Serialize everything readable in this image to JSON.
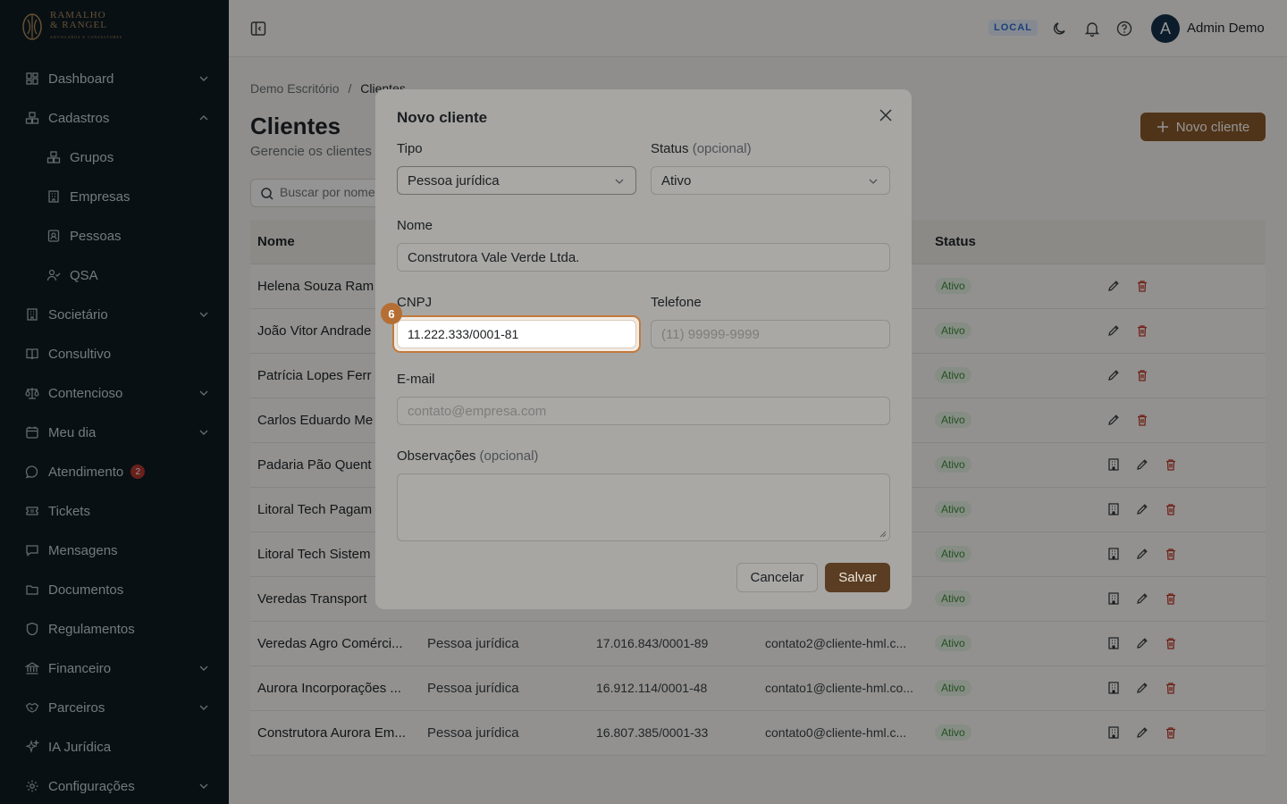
{
  "brand": {
    "name_line1": "RAMALHO",
    "name_line2": "& RANGEL",
    "tagline": "ADVOGADOS E CONSULTORES"
  },
  "sidebar": {
    "items": [
      {
        "label": "Dashboard",
        "icon": "dashboard-icon",
        "chevron": "down"
      },
      {
        "label": "Cadastros",
        "icon": "boxes-icon",
        "chevron": "up"
      },
      {
        "label": "Grupos",
        "icon": "boxes-icon",
        "sub": true
      },
      {
        "label": "Empresas",
        "icon": "building-icon",
        "sub": true
      },
      {
        "label": "Pessoas",
        "icon": "contact-icon",
        "sub": true
      },
      {
        "label": "QSA",
        "icon": "user-check-icon",
        "sub": true
      },
      {
        "label": "Societário",
        "icon": "building-icon",
        "chevron": "down"
      },
      {
        "label": "Consultivo",
        "icon": "book-icon"
      },
      {
        "label": "Contencioso",
        "icon": "scale-icon",
        "chevron": "down"
      },
      {
        "label": "Meu dia",
        "icon": "calendar-icon",
        "chevron": "down"
      },
      {
        "label": "Atendimento",
        "icon": "chat-icon",
        "badge": "2"
      },
      {
        "label": "Tickets",
        "icon": "ticket-icon"
      },
      {
        "label": "Mensagens",
        "icon": "message-icon"
      },
      {
        "label": "Documentos",
        "icon": "folder-icon"
      },
      {
        "label": "Regulamentos",
        "icon": "shield-icon"
      },
      {
        "label": "Financeiro",
        "icon": "bank-icon",
        "chevron": "down"
      },
      {
        "label": "Parceiros",
        "icon": "handshake-icon",
        "chevron": "down"
      },
      {
        "label": "IA Jurídica",
        "icon": "sparkles-icon"
      },
      {
        "label": "Configurações",
        "icon": "gear-icon",
        "chevron": "down"
      }
    ]
  },
  "topbar": {
    "env": "LOCAL",
    "avatar_letter": "A",
    "user_name": "Admin Demo"
  },
  "main": {
    "breadcrumb": {
      "root": "Demo Escritório",
      "sep": "/",
      "current": "Clientes"
    },
    "title": "Clientes",
    "subtitle": "Gerencie os clientes",
    "new_button": "Novo cliente",
    "search_placeholder": "Buscar por nome",
    "columns": {
      "name": "Nome",
      "status": "Status"
    },
    "rows": [
      {
        "name": "Helena Souza Ram",
        "tipo": "",
        "doc": "",
        "email": "",
        "status": "Ativo",
        "company": false
      },
      {
        "name": "João Vitor Andrade",
        "tipo": "",
        "doc": "",
        "email": "",
        "status": "Ativo",
        "company": false
      },
      {
        "name": "Patrícia Lopes Ferr",
        "tipo": "",
        "doc": "",
        "email": "",
        "status": "Ativo",
        "company": false
      },
      {
        "name": "Carlos Eduardo Me",
        "tipo": "",
        "doc": "",
        "email": "",
        "status": "Ativo",
        "company": false
      },
      {
        "name": "Padaria Pão Quent",
        "tipo": "",
        "doc": "",
        "email": "",
        "status": "Ativo",
        "company": true
      },
      {
        "name": "Litoral Tech Pagam",
        "tipo": "",
        "doc": "",
        "email": "",
        "status": "Ativo",
        "company": true
      },
      {
        "name": "Litoral Tech Sistem",
        "tipo": "",
        "doc": "",
        "email": "",
        "status": "Ativo",
        "company": true
      },
      {
        "name": "Veredas Transport",
        "tipo": "",
        "doc": "",
        "email": "",
        "status": "Ativo",
        "company": true
      },
      {
        "name": "Veredas Agro Comérci...",
        "tipo": "Pessoa jurídica",
        "doc": "17.016.843/0001-89",
        "email": "contato2@cliente-hml.c...",
        "status": "Ativo",
        "company": true
      },
      {
        "name": "Aurora Incorporações ...",
        "tipo": "Pessoa jurídica",
        "doc": "16.912.114/0001-48",
        "email": "contato1@cliente-hml.co...",
        "status": "Ativo",
        "company": true
      },
      {
        "name": "Construtora Aurora Em...",
        "tipo": "Pessoa jurídica",
        "doc": "16.807.385/0001-33",
        "email": "contato0@cliente-hml.c...",
        "status": "Ativo",
        "company": true
      }
    ]
  },
  "modal": {
    "title": "Novo cliente",
    "tipo_label": "Tipo",
    "tipo_value": "Pessoa jurídica",
    "status_label": "Status",
    "status_optional": "(opcional)",
    "status_value": "Ativo",
    "nome_label": "Nome",
    "nome_value": "Construtora Vale Verde Ltda.",
    "cnpj_label": "CNPJ",
    "cnpj_value": "11.222.333/0001-81",
    "telefone_label": "Telefone",
    "telefone_placeholder": "(11) 99999-9999",
    "email_label": "E-mail",
    "email_placeholder": "contato@empresa.com",
    "obs_label": "Observações",
    "obs_optional": "(opcional)",
    "step_badge": "6",
    "cancel": "Cancelar",
    "save": "Salvar"
  },
  "colors": {
    "sidebar_bg": "#0f1c24",
    "accent": "#8a5a2b",
    "focus_ring": "#c27a3d",
    "status_green": "#3d8a3a",
    "danger": "#c0392b"
  }
}
